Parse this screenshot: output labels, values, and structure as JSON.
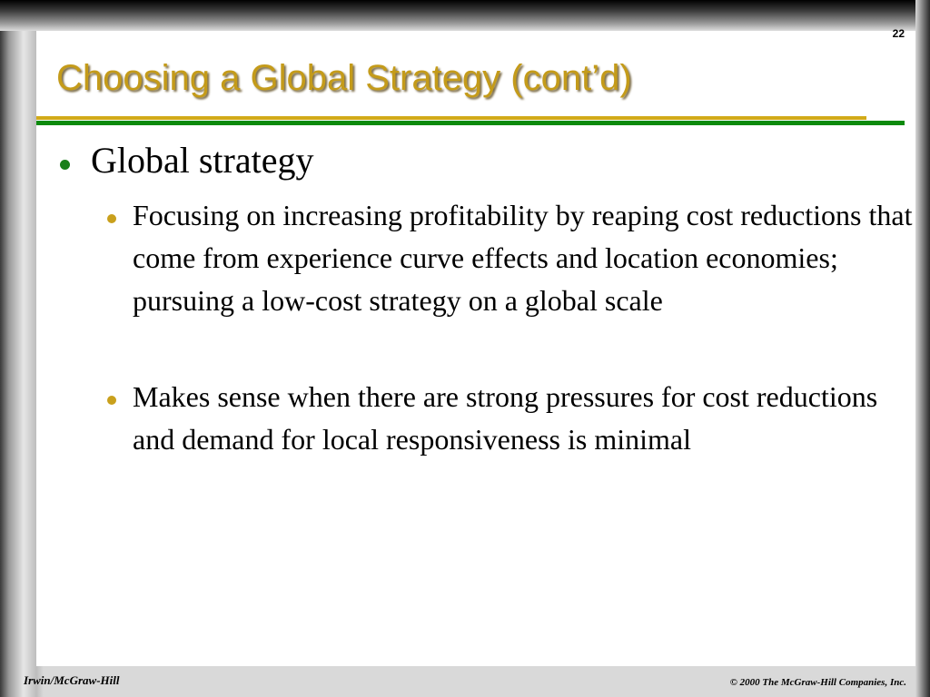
{
  "slide": {
    "number": "22",
    "title": "Choosing a Global Strategy (cont’d)",
    "colors": {
      "title": "#c49b1a",
      "rule_gold": "#d2aa18",
      "rule_green": "#0c8a0c",
      "bullet_level1": "#1a7f1a",
      "bullet_level2": "#c9a01c"
    },
    "bullets": [
      {
        "text": "Global strategy",
        "children": [
          {
            "text": "Focusing on increasing profitability by reaping cost reductions that come from experience curve effects and location economies; pursuing a low-cost strategy on a global scale"
          },
          {
            "text": "Makes sense when there are strong pressures for cost reductions and demand for local responsiveness is minimal"
          }
        ]
      }
    ]
  },
  "footer": {
    "left": "Irwin/McGraw-Hill",
    "right": "© 2000 The McGraw-Hill Companies, Inc."
  }
}
